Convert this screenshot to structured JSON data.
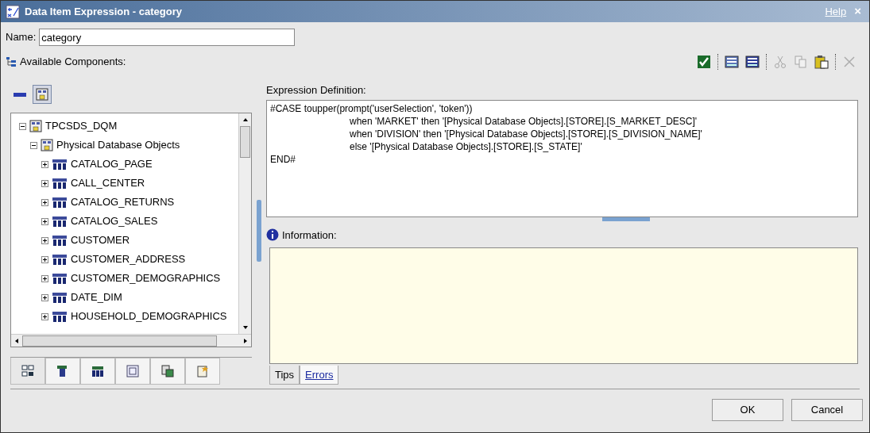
{
  "window": {
    "title": "Data Item Expression - category",
    "help": "Help",
    "close": "×"
  },
  "name_field": {
    "label": "Name:",
    "value": "category"
  },
  "available_label": "Available Components:",
  "view_toggles": [
    {
      "kind": "bar",
      "selected": false
    },
    {
      "kind": "tree",
      "selected": true
    }
  ],
  "toolbar": [
    {
      "kind": "validate",
      "disabled": false
    },
    {
      "kind": "list",
      "disabled": false
    },
    {
      "kind": "list-dark",
      "disabled": false
    },
    {
      "kind": "cut",
      "disabled": true
    },
    {
      "kind": "copy",
      "disabled": true
    },
    {
      "kind": "paste",
      "disabled": false
    },
    {
      "kind": "delete",
      "disabled": true
    }
  ],
  "tree": [
    {
      "label": "TPCSDS_DQM",
      "kind": "package",
      "expanded": true,
      "children": [
        {
          "label": "Physical Database Objects",
          "kind": "folder",
          "expanded": true,
          "children": [
            {
              "label": "CATALOG_PAGE",
              "kind": "table",
              "expanded": false
            },
            {
              "label": "CALL_CENTER",
              "kind": "table",
              "expanded": false
            },
            {
              "label": "CATALOG_RETURNS",
              "kind": "table",
              "expanded": false
            },
            {
              "label": "CATALOG_SALES",
              "kind": "table",
              "expanded": false
            },
            {
              "label": "CUSTOMER",
              "kind": "table",
              "expanded": false
            },
            {
              "label": "CUSTOMER_ADDRESS",
              "kind": "table",
              "expanded": false
            },
            {
              "label": "CUSTOMER_DEMOGRAPHICS",
              "kind": "table",
              "expanded": false
            },
            {
              "label": "DATE_DIM",
              "kind": "table",
              "expanded": false
            },
            {
              "label": "HOUSEHOLD_DEMOGRAPHICS",
              "kind": "table",
              "expanded": false
            }
          ]
        }
      ]
    }
  ],
  "component_tabs": [
    {
      "kind": "source",
      "selected": true
    },
    {
      "kind": "data-items",
      "selected": false
    },
    {
      "kind": "query-items",
      "selected": false
    },
    {
      "kind": "functions",
      "selected": false
    },
    {
      "kind": "parameters",
      "selected": false
    },
    {
      "kind": "macros",
      "selected": false
    }
  ],
  "expression": {
    "label": "Expression Definition:",
    "lines": [
      {
        "text": "#CASE toupper(prompt('userSelection', 'token'))",
        "kind": "plain"
      },
      {
        "text": "when 'MARKET' then '[Physical Database Objects].[STORE].[S_MARKET_DESC]'",
        "kind": "indented"
      },
      {
        "text": "when 'DIVISION' then '[Physical Database Objects].[STORE].[S_DIVISION_NAME]'",
        "kind": "indented"
      },
      {
        "text": "else '[Physical Database Objects].[STORE].[S_STATE]'",
        "kind": "indented"
      },
      {
        "text": "END#",
        "kind": "plain"
      }
    ]
  },
  "information": {
    "label": "Information:"
  },
  "info_tabs": [
    {
      "label": "Tips",
      "selected": true
    },
    {
      "label": "Errors",
      "selected": false
    }
  ],
  "buttons": [
    "OK",
    "Cancel"
  ]
}
